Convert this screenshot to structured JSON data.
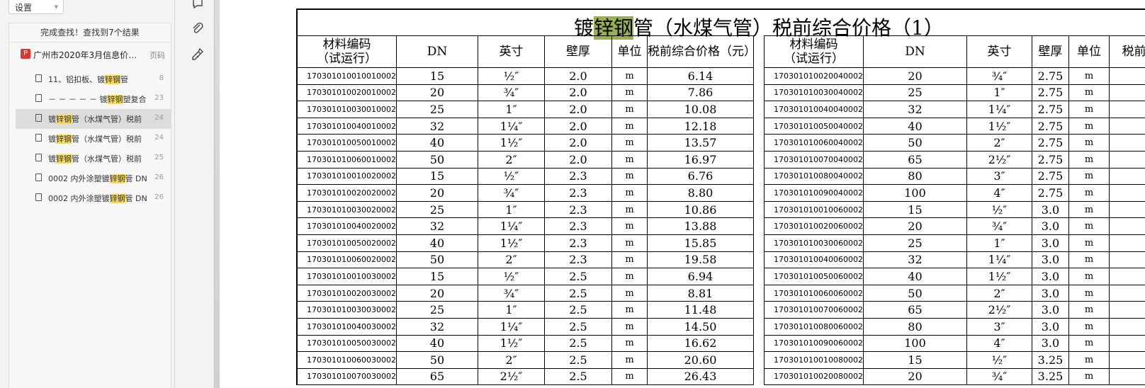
{
  "sidebar": {
    "settings_label": "设置",
    "status": "完成查找！查找到7个结果",
    "document": {
      "title": "广州市2020年3月信息价…",
      "page_label": "页码"
    },
    "results": [
      {
        "pre": "11、铝扣板、镀",
        "hl": "锌钢",
        "post": "管",
        "page": "8"
      },
      {
        "pre": "－ － － － － 镀",
        "hl": "锌钢",
        "post": "塑复合",
        "page": "23"
      },
      {
        "pre": "镀",
        "hl": "锌钢",
        "post": "管（水煤气管）税前",
        "page": "24"
      },
      {
        "pre": "镀",
        "hl": "锌钢",
        "post": "管（水煤气管）税前",
        "page": "24"
      },
      {
        "pre": "镀",
        "hl": "锌钢",
        "post": "管（水煤气管）税前",
        "page": "25"
      },
      {
        "pre": "0002 内外涂塑镀",
        "hl": "锌钢",
        "post": "管 DN",
        "page": "26"
      },
      {
        "pre": "0002 内外涂塑镀",
        "hl": "锌钢",
        "post": "管 DN",
        "page": "26"
      }
    ]
  },
  "toolbar": {
    "icons": [
      "comment-icon",
      "attachment-icon",
      "signature-icon"
    ]
  },
  "document_page": {
    "title_pre": "镀",
    "title_hl": "锌钢",
    "title_post": "管（水煤气管）税前综合价格（1）",
    "headers": [
      "材料编码\n（试运行）",
      "DN",
      "英寸",
      "壁厚",
      "单位",
      "税前综合价格（元）"
    ],
    "headers_right": [
      "材料编码\n（试运行）",
      "DN",
      "英寸",
      "壁厚",
      "单位",
      "税前"
    ],
    "left_rows": [
      [
        "17030101001001000​2",
        "15",
        "½″",
        "2.0",
        "m",
        "6.14"
      ],
      [
        "170301010020010002",
        "20",
        "¾″",
        "2.0",
        "m",
        "7.86"
      ],
      [
        "170301010030010002",
        "25",
        "1″",
        "2.0",
        "m",
        "10.08"
      ],
      [
        "170301010040010002",
        "32",
        "1¼″",
        "2.0",
        "m",
        "12.18"
      ],
      [
        "170301010050010002",
        "40",
        "1½″",
        "2.0",
        "m",
        "13.57"
      ],
      [
        "170301010060010002",
        "50",
        "2″",
        "2.0",
        "m",
        "16.97"
      ],
      [
        "170301010010020002",
        "15",
        "½″",
        "2.3",
        "m",
        "6.76"
      ],
      [
        "170301010020020002",
        "20",
        "¾″",
        "2.3",
        "m",
        "8.80"
      ],
      [
        "170301010030020002",
        "25",
        "1″",
        "2.3",
        "m",
        "10.86"
      ],
      [
        "170301010040020002",
        "32",
        "1¼″",
        "2.3",
        "m",
        "13.88"
      ],
      [
        "170301010050020002",
        "40",
        "1½″",
        "2.3",
        "m",
        "15.85"
      ],
      [
        "170301010060020002",
        "50",
        "2″",
        "2.3",
        "m",
        "19.58"
      ],
      [
        "170301010010030002",
        "15",
        "½″",
        "2.5",
        "m",
        "6.94"
      ],
      [
        "170301010020030002",
        "20",
        "¾″",
        "2.5",
        "m",
        "8.81"
      ],
      [
        "170301010030030002",
        "25",
        "1″",
        "2.5",
        "m",
        "11.48"
      ],
      [
        "170301010040030002",
        "32",
        "1¼″",
        "2.5",
        "m",
        "14.50"
      ],
      [
        "170301010050030002",
        "40",
        "1½″",
        "2.5",
        "m",
        "16.62"
      ],
      [
        "170301010060030002",
        "50",
        "2″",
        "2.5",
        "m",
        "20.60"
      ],
      [
        "170301010070030002",
        "65",
        "2½″",
        "2.5",
        "m",
        "26.43"
      ]
    ],
    "right_rows": [
      [
        "170301010020040002",
        "20",
        "¾″",
        "2.75",
        "m"
      ],
      [
        "170301010030040002",
        "25",
        "1″",
        "2.75",
        "m"
      ],
      [
        "170301010040040002",
        "32",
        "1¼″",
        "2.75",
        "m"
      ],
      [
        "170301010050040002",
        "40",
        "1½″",
        "2.75",
        "m"
      ],
      [
        "170301010060040002",
        "50",
        "2″",
        "2.75",
        "m"
      ],
      [
        "170301010070040002",
        "65",
        "2½″",
        "2.75",
        "m"
      ],
      [
        "170301010080040002",
        "80",
        "3″",
        "2.75",
        "m"
      ],
      [
        "170301010090040002",
        "100",
        "4″",
        "2.75",
        "m"
      ],
      [
        "170301010010060002",
        "15",
        "½″",
        "3.0",
        "m"
      ],
      [
        "170301010020060002",
        "20",
        "¾″",
        "3.0",
        "m"
      ],
      [
        "170301010030060002",
        "25",
        "1″",
        "3.0",
        "m"
      ],
      [
        "170301010040060002",
        "32",
        "1¼″",
        "3.0",
        "m"
      ],
      [
        "170301010050060002",
        "40",
        "1½″",
        "3.0",
        "m"
      ],
      [
        "170301010060060002",
        "50",
        "2″",
        "3.0",
        "m"
      ],
      [
        "170301010070060002",
        "65",
        "2½″",
        "3.0",
        "m"
      ],
      [
        "170301010080060002",
        "80",
        "3″",
        "3.0",
        "m"
      ],
      [
        "170301010090060002",
        "100",
        "4″",
        "3.0",
        "m"
      ],
      [
        "170301010010080002",
        "15",
        "½″",
        "3.25",
        "m"
      ],
      [
        "170301010020080002",
        "20",
        "¾″",
        "3.25",
        "m"
      ]
    ]
  },
  "colors": {
    "search_highlight": "#f6d85b",
    "title_highlight": "#9ab04f",
    "pdf_icon": "#e0342c"
  }
}
